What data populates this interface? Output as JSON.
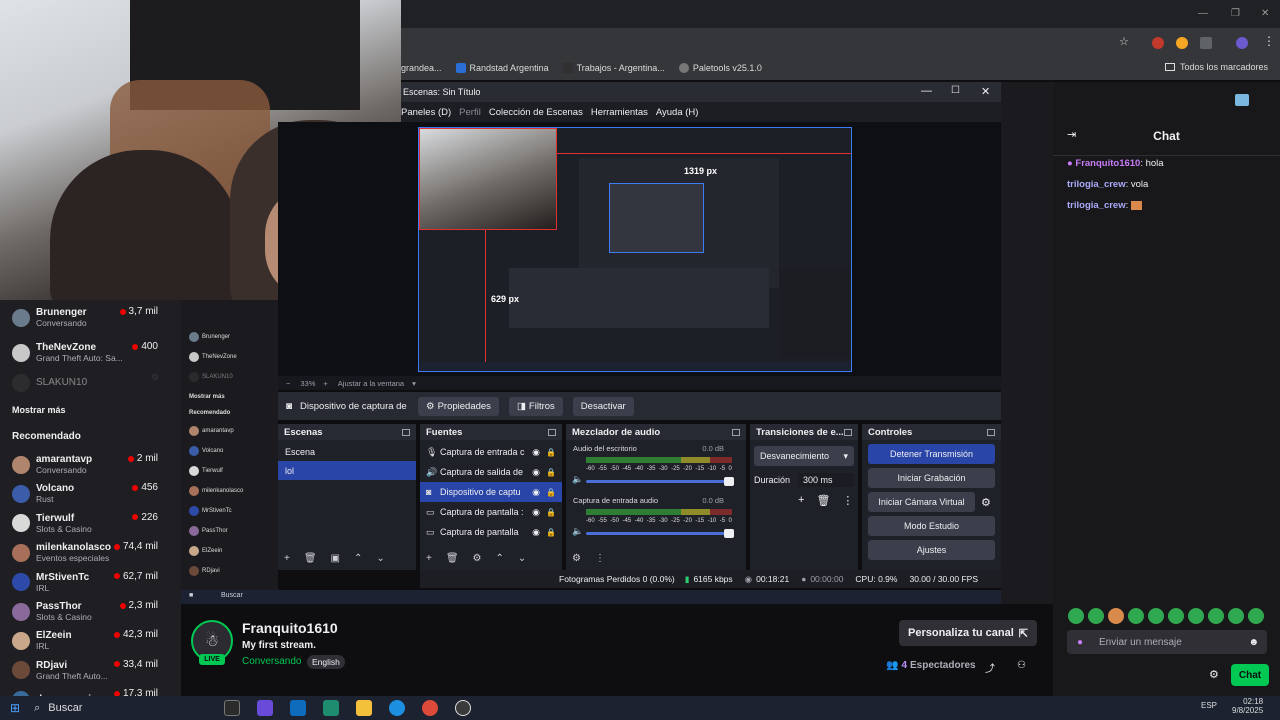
{
  "camera": {},
  "browser": {
    "bookmarks": [
      {
        "label": "grandea...",
        "color": "#4a4a4a"
      },
      {
        "label": "Randstad Argentina",
        "color": "#2b6fd6"
      },
      {
        "label": "Trabajos - Argentina...",
        "color": "#303030"
      },
      {
        "label": "Paletools v25.1.0",
        "color": "#777777"
      }
    ],
    "bookmarks_all": "Todos los marcadores"
  },
  "obs": {
    "title": "Escenas: Sin Título",
    "menu": [
      "Paneles (D)",
      "Perfil",
      "Colección de Escenas",
      "Herramientas",
      "Ayuda (H)"
    ],
    "preview_label_w": "1319 px",
    "preview_label_h": "629 px",
    "zoom": "33%",
    "fit": "Ajustar a la ventana",
    "source_toolbar": {
      "source": "Dispositivo de captura de v",
      "properties": "Propiedades",
      "filters": "Filtros",
      "deactivate": "Desactivar"
    },
    "scenes": {
      "title": "Escenas",
      "items": [
        "Escena",
        "lol"
      ],
      "selected": 1
    },
    "sources": {
      "title": "Fuentes",
      "items": [
        {
          "icon": "mic-icon",
          "label": "Captura de entrada c"
        },
        {
          "icon": "speaker-icon",
          "label": "Captura de salida de"
        },
        {
          "icon": "camera-icon",
          "label": "Dispositivo de captu"
        },
        {
          "icon": "monitor-icon",
          "label": "Captura de pantalla :"
        },
        {
          "icon": "monitor-icon",
          "label": "Captura de pantalla"
        }
      ],
      "selected": 2
    },
    "mixer": {
      "title": "Mezclador de audio",
      "channels": [
        {
          "name": "Audio del escritorio",
          "db": "0.0 dB"
        },
        {
          "name": "Captura de entrada audio",
          "db": "0.0 dB"
        }
      ],
      "scale": [
        "-60",
        "-55",
        "-50",
        "-45",
        "-40",
        "-35",
        "-30",
        "-25",
        "-20",
        "-15",
        "-10",
        "-5",
        "0"
      ]
    },
    "transitions": {
      "title": "Transiciones de e...",
      "selected": "Desvanecimiento",
      "duration_label": "Duración",
      "duration_value": "300 ms"
    },
    "controls": {
      "title": "Controles",
      "buttons": [
        "Detener Transmisión",
        "Iniciar Grabación",
        "Iniciar Cámara Virtual",
        "Modo Estudio",
        "Ajustes"
      ]
    },
    "status": {
      "dropped": "Fotogramas Perdidos 0 (0.0%)",
      "bitrate": "6165 kbps",
      "live_time": "00:18:21",
      "rec_time": "00:00:00",
      "cpu": "CPU: 0.9%",
      "fps": "30.00 / 30.00 FPS"
    }
  },
  "sidebar": {
    "channels": [
      {
        "name": "Brunenger",
        "game": "Conversando",
        "viewers": "3,7 mil",
        "color": "#6a7b8c"
      },
      {
        "name": "TheNevZone",
        "game": "Grand Theft Auto: Sa...",
        "viewers": "400",
        "color": "#c8c8c8"
      },
      {
        "name": "SLAKUN10",
        "game": "",
        "viewers": "",
        "color": "#3a3a3a"
      }
    ],
    "show_more": "Mostrar más",
    "recommended_title": "Recomendado",
    "recommended": [
      {
        "name": "amarantavp",
        "game": "Conversando",
        "viewers": "2 mil",
        "color": "#b0856e"
      },
      {
        "name": "Volcano",
        "game": "Rust",
        "viewers": "456",
        "color": "#3b5ca8"
      },
      {
        "name": "Tierwulf",
        "game": "Slots & Casino",
        "viewers": "226",
        "color": "#d9d9d9"
      },
      {
        "name": "milenkanolasco",
        "game": "Eventos especiales",
        "viewers": "74,4 mil",
        "color": "#a8705a"
      },
      {
        "name": "MrStivenTc",
        "game": "IRL",
        "viewers": "62,7 mil",
        "color": "#2e4aa8"
      },
      {
        "name": "PassThor",
        "game": "Slots & Casino",
        "viewers": "2,3 mil",
        "color": "#8a6a9a"
      },
      {
        "name": "ElZeein",
        "game": "IRL",
        "viewers": "42,3 mil",
        "color": "#c9a78a"
      },
      {
        "name": "RDjavi",
        "game": "Grand Theft Auto...",
        "viewers": "33,4 mil",
        "color": "#6b4a3a"
      },
      {
        "name": "davooxeneize",
        "game": "",
        "viewers": "17,3 mil",
        "color": "#3a6a9a"
      }
    ]
  },
  "stream": {
    "channel": "Franquito1610",
    "title": "My first stream.",
    "category": "Conversando",
    "language": "English",
    "live": "LIVE",
    "customize": "Personaliza tu canal",
    "viewers": "4",
    "viewers_label": "Espectadores"
  },
  "chat": {
    "title": "Chat",
    "messages": [
      {
        "user": "Franquito1610",
        "text": "hola",
        "color": "#c87cf5"
      },
      {
        "user": "trilogia_crew",
        "text": "vola",
        "color": "#aaaaf9"
      },
      {
        "user": "trilogia_crew",
        "text": "",
        "color": "#aaaaf9"
      }
    ],
    "placeholder": "Enviar un mensaje",
    "send": "Chat"
  },
  "taskbar": {
    "search": "Buscar",
    "lang": "ESP",
    "time": "02:18",
    "date": "9/8/2025"
  }
}
